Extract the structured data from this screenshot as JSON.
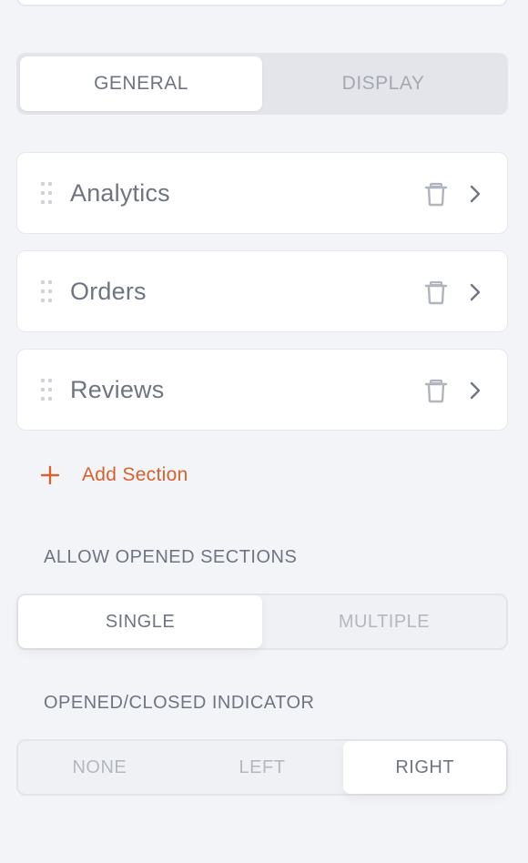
{
  "tabs": {
    "items": [
      {
        "label": "GENERAL",
        "active": true
      },
      {
        "label": "DISPLAY",
        "active": false
      }
    ]
  },
  "sections": [
    {
      "label": "Analytics"
    },
    {
      "label": "Orders"
    },
    {
      "label": "Reviews"
    }
  ],
  "add_section_label": "Add Section",
  "allow_opened": {
    "label": "ALLOW OPENED SECTIONS",
    "options": [
      {
        "label": "SINGLE",
        "selected": true
      },
      {
        "label": "MULTIPLE",
        "selected": false
      }
    ]
  },
  "indicator": {
    "label": "OPENED/CLOSED INDICATOR",
    "options": [
      {
        "label": "NONE",
        "selected": false
      },
      {
        "label": "LEFT",
        "selected": false
      },
      {
        "label": "RIGHT",
        "selected": true
      }
    ]
  },
  "colors": {
    "accent": "#d4622f",
    "background": "#f3f4f8",
    "text": "#6e7581",
    "muted": "#b3b7bf"
  },
  "icons": {
    "drag": "drag-handle-icon",
    "delete": "trash-icon",
    "open": "chevron-right-icon",
    "add": "plus-icon"
  }
}
